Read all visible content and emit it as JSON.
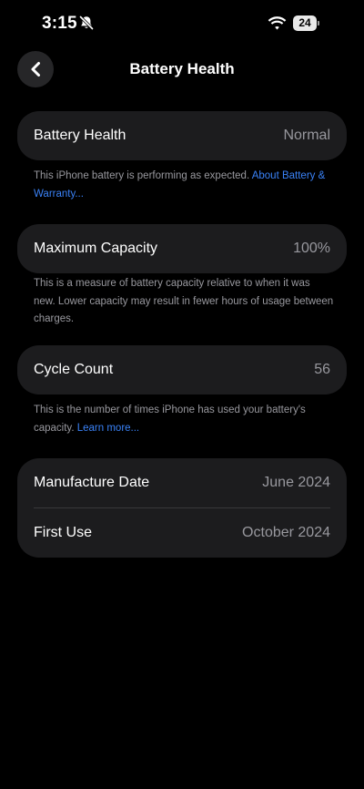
{
  "status_bar": {
    "time": "3:15",
    "battery_level": "24"
  },
  "nav": {
    "title": "Battery Health",
    "back_icon": "chevron-left-icon"
  },
  "battery_health": {
    "label": "Battery Health",
    "value": "Normal",
    "note": "This iPhone battery is performing as expected.",
    "link": "About Battery & Warranty..."
  },
  "maximum_capacity": {
    "label": "Maximum Capacity",
    "value": "100%",
    "note": "This is a measure of battery capacity relative to when it was new. Lower capacity may result in fewer hours of usage between charges."
  },
  "cycle_count": {
    "label": "Cycle Count",
    "value": "56",
    "note": "This is the number of times iPhone has used your battery's capacity.",
    "link": "Learn more..."
  },
  "dates": {
    "manufacture_label": "Manufacture Date",
    "manufacture_value": "June 2024",
    "first_use_label": "First Use",
    "first_use_value": "October 2024"
  },
  "colors": {
    "background": "#000000",
    "card": "#1c1c1e",
    "secondary_text": "#98989e",
    "link": "#3a82f7"
  }
}
